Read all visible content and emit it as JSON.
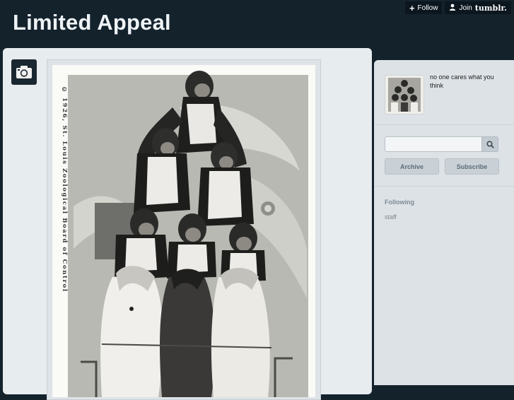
{
  "blog": {
    "title": "Limited Appeal"
  },
  "tumblr_controls": {
    "follow_label": "Follow",
    "join_label": "Join",
    "brand": "tumblr."
  },
  "post": {
    "type_icon": "camera-icon",
    "photo_caption": "© 1926, St. Louis Zoological Board of Control"
  },
  "sidebar": {
    "description": "no one cares what you think",
    "search": {
      "placeholder": "",
      "button_icon": "search-icon"
    },
    "archive_label": "Archive",
    "subscribe_label": "Subscribe",
    "following_heading": "Following",
    "following": [
      "staff"
    ]
  },
  "colors": {
    "header_bg": "#14222c",
    "panel_bg": "#e7ecef",
    "sidebar_bg": "#dde2e6"
  }
}
